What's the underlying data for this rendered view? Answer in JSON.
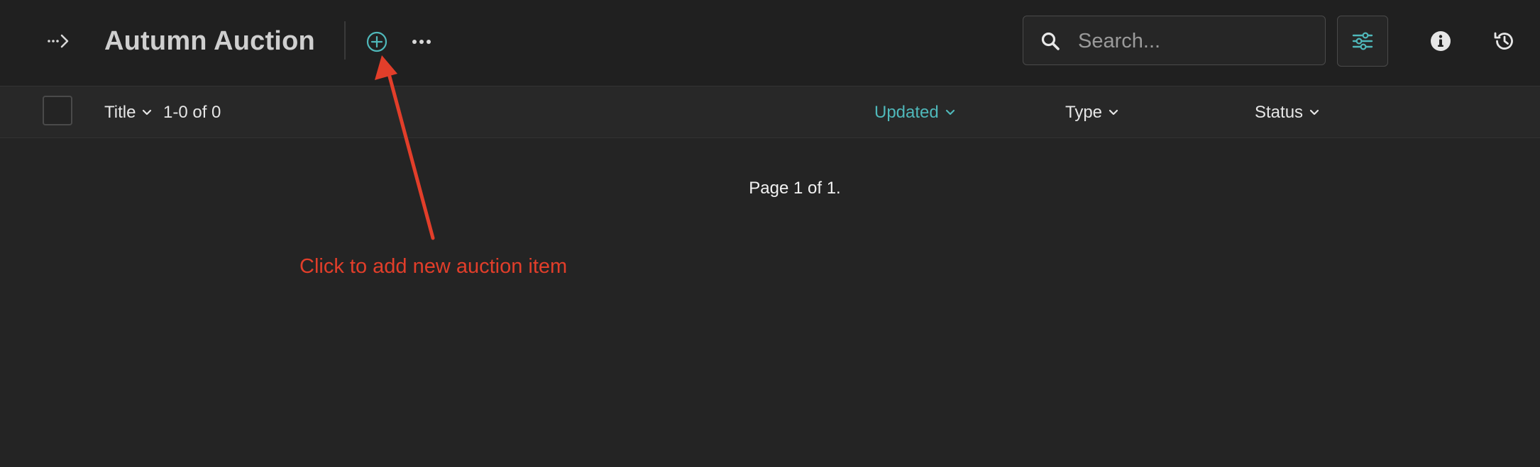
{
  "header": {
    "title": "Autumn Auction",
    "icons": {
      "expand": "expand-sidebar-icon",
      "add": "add-circle-icon",
      "more": "more-horizontal-icon",
      "search": "search-icon",
      "filter": "sliders-icon",
      "info": "info-icon",
      "history": "history-icon"
    },
    "search": {
      "placeholder": "Search...",
      "value": ""
    }
  },
  "table": {
    "columns": {
      "title": "Title",
      "updated": "Updated",
      "type": "Type",
      "status": "Status"
    },
    "count": "1-0 of 0",
    "pagination": "Page 1 of 1."
  },
  "annotation": {
    "text": "Click to add new auction item"
  },
  "colors": {
    "background": "#242424",
    "accent": "#4fb8ba",
    "annotation": "#e23e2a"
  }
}
